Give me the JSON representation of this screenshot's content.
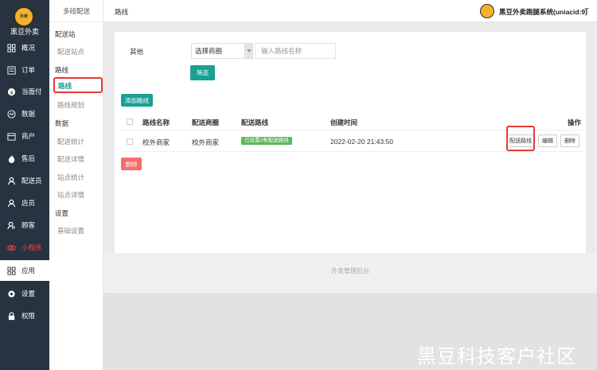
{
  "brand": {
    "name": "黑豆外卖",
    "logo_text": "外卖"
  },
  "sidebar": {
    "items": [
      {
        "label": "概况",
        "icon": "grid-icon"
      },
      {
        "label": "订单",
        "icon": "list-icon"
      },
      {
        "label": "当面付",
        "icon": "coin-icon"
      },
      {
        "label": "数据",
        "icon": "chart-icon"
      },
      {
        "label": "商户",
        "icon": "store-icon"
      },
      {
        "label": "售后",
        "icon": "fire-icon"
      },
      {
        "label": "配送员",
        "icon": "user-icon"
      },
      {
        "label": "店员",
        "icon": "user-icon"
      },
      {
        "label": "顾客",
        "icon": "user-search-icon"
      },
      {
        "label": "小程序",
        "icon": "miniapp-icon"
      },
      {
        "label": "应用",
        "icon": "apps-icon"
      },
      {
        "label": "设置",
        "icon": "gear-icon"
      },
      {
        "label": "权限",
        "icon": "lock-icon"
      }
    ]
  },
  "subnav": {
    "title": "多段配送",
    "sections": [
      {
        "heading": "配送站",
        "items": [
          "配送站点"
        ]
      },
      {
        "heading": "路线",
        "items": [
          "路线",
          "路线规划"
        ]
      },
      {
        "heading": "数据",
        "items": [
          "配送统计",
          "配送详情",
          "站点统计",
          "站点详情"
        ]
      },
      {
        "heading": "设置",
        "items": [
          "基础设置"
        ]
      }
    ]
  },
  "topbar": {
    "page_title": "路线",
    "user": "黑豆外卖跑腿系统(uniacid:9)"
  },
  "filter": {
    "label": "其他",
    "select_value": "选择商圈",
    "input_placeholder": "输入路线名称",
    "filter_button": "筛选"
  },
  "toolbar": {
    "add_button": "添加路线",
    "delete_button": "删除"
  },
  "table": {
    "headers": [
      "路线名称",
      "配送商圈",
      "配送路线",
      "创建时间",
      "操作"
    ],
    "rows": [
      {
        "name": "校外商家",
        "area": "校外商家",
        "route_badge": "已设置2条配送路线",
        "created": "2022-02-20 21:43:50",
        "actions": [
          "配送路线",
          "编辑",
          "删除"
        ]
      }
    ]
  },
  "footer": {
    "text": "外卖管理后台"
  },
  "watermark": "黑豆科技客户社区",
  "colors": {
    "accent": "#1aa094",
    "sidebar_bg": "#273340",
    "danger": "#f76b6b",
    "highlight": "#e53935"
  }
}
